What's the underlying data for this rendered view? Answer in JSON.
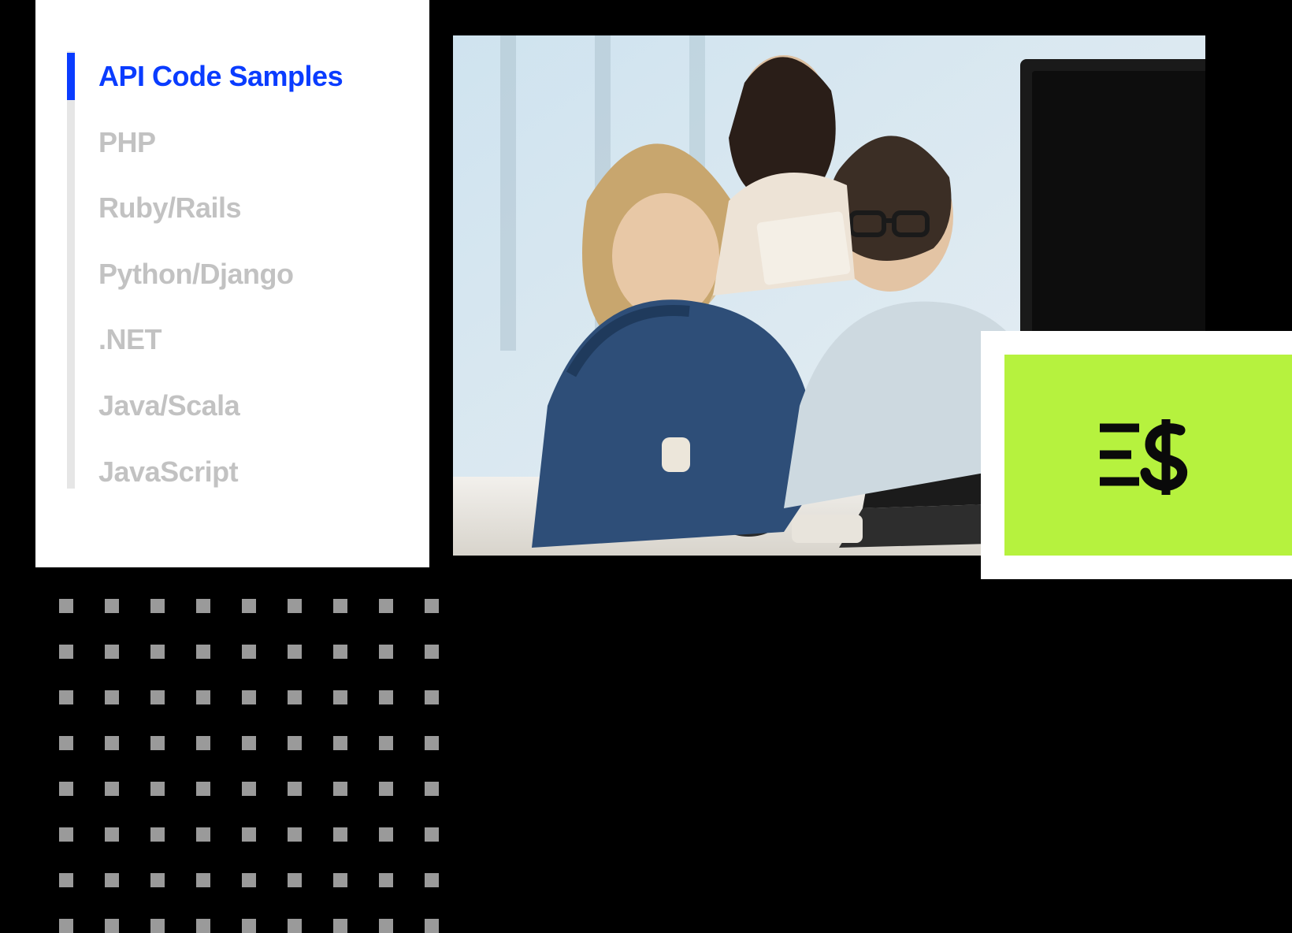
{
  "sidebar": {
    "items": [
      {
        "label": "API Code Samples",
        "active": true
      },
      {
        "label": "PHP",
        "active": false
      },
      {
        "label": "Ruby/Rails",
        "active": false
      },
      {
        "label": "Python/Django",
        "active": false
      },
      {
        "label": ".NET",
        "active": false
      },
      {
        "label": "Java/Scala",
        "active": false
      },
      {
        "label": "JavaScript",
        "active": false
      }
    ]
  },
  "badge": {
    "icon_name": "list-dollar-icon",
    "accent_color": "#b6f23e"
  },
  "photo": {
    "description": "office-developers-collaborating"
  },
  "colors": {
    "active": "#0a3cff",
    "inactive": "#c2c2c2",
    "rail": "#e6e6e6",
    "badge_accent": "#b6f23e",
    "dot": "#9a9a9a"
  },
  "dot_grid": {
    "rows": 8,
    "cols": 9
  }
}
